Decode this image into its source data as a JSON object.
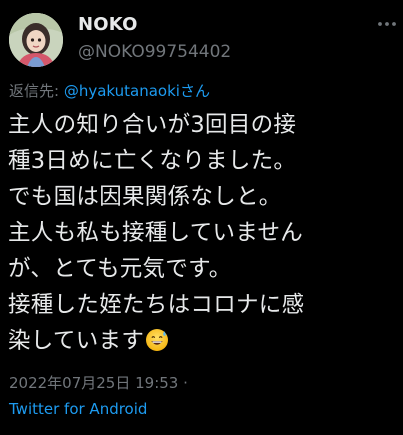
{
  "author": {
    "display_name": "NOKO",
    "handle": "@NOKO99754402"
  },
  "reply": {
    "prefix": "返信先: ",
    "mention": "@hyakutanaokiさん"
  },
  "tweet": {
    "text": "主人の知り合いが3回目の接\n種3日めに亡くなりました。\nでも国は因果関係なしと。\n主人も私も接種していません\nが、とても元気です。\n接種した姪たちはコロナに感\n染しています",
    "emoji": "grinning-face-with-sweat-emoji"
  },
  "meta": {
    "timestamp": "2022年07月25日 19:53 ·",
    "source": "Twitter for Android"
  },
  "icons": {
    "more": "more-options-icon",
    "avatar": "avatar"
  },
  "colors": {
    "background": "#000000",
    "text": "#e7e9ea",
    "muted": "#71767b",
    "accent": "#1d9bf0"
  }
}
